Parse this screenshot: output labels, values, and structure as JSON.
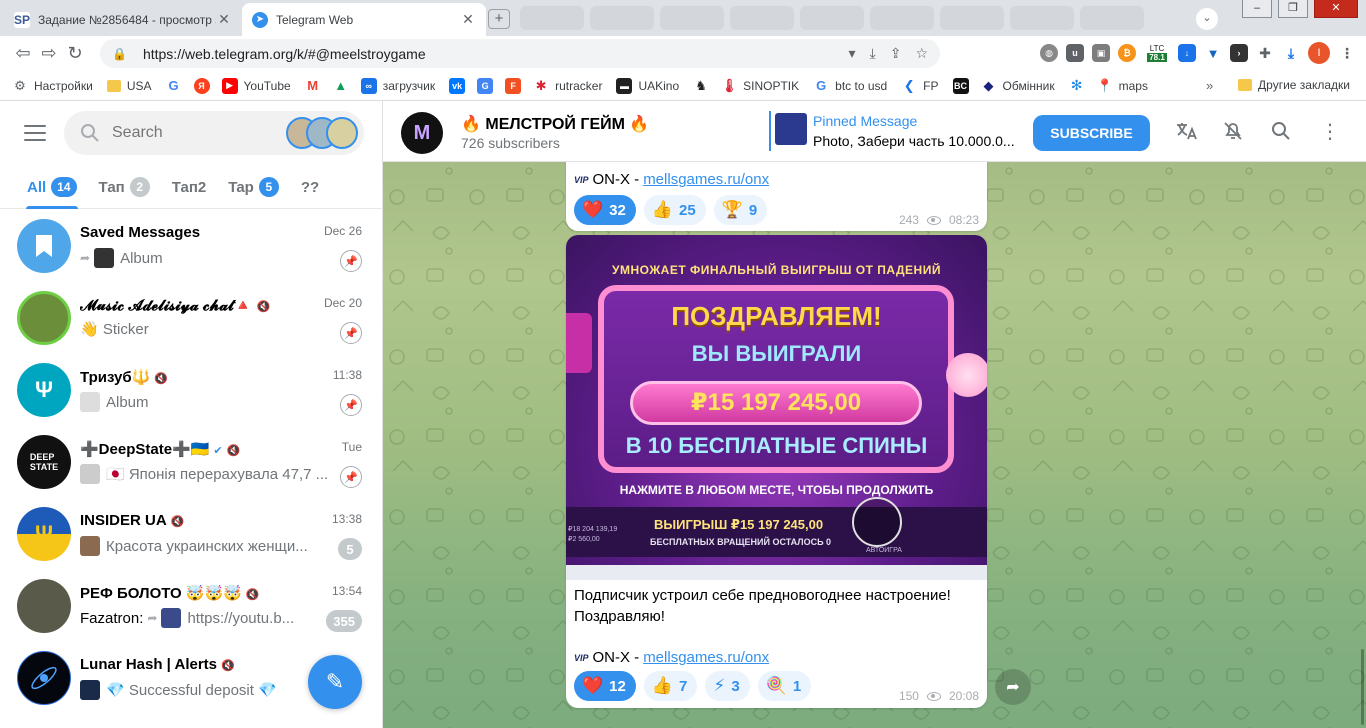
{
  "browser": {
    "tabs": [
      {
        "title": "Задание №2856484 - просмотр з",
        "favicon": "SP",
        "active": false
      },
      {
        "title": "Telegram Web",
        "favicon": "telegram-icon",
        "active": true
      }
    ],
    "url": "https://web.telegram.org/k/#@meelstroygame",
    "ext_ltc": {
      "label": "LTC",
      "value": "78.1",
      "sub": "88865"
    },
    "profile_initial": "I",
    "bookmarks": [
      {
        "label": "Настройки",
        "icon": "gear-icon"
      },
      {
        "label": "USA",
        "icon": "folder-icon"
      },
      {
        "label": "",
        "icon": "google-icon"
      },
      {
        "label": "",
        "icon": "yandex-icon"
      },
      {
        "label": "YouTube",
        "icon": "youtube-icon"
      },
      {
        "label": "",
        "icon": "gmail-icon"
      },
      {
        "label": "",
        "icon": "drive-icon"
      },
      {
        "label": "загрузчик",
        "icon": "infinity-icon"
      },
      {
        "label": "",
        "icon": "vk-icon"
      },
      {
        "label": "",
        "icon": "translate-icon"
      },
      {
        "label": "",
        "icon": "f-icon"
      },
      {
        "label": "rutracker",
        "icon": "rutracker-icon"
      },
      {
        "label": "UAKino",
        "icon": "uakino-icon"
      },
      {
        "label": "",
        "icon": "chess-icon"
      },
      {
        "label": "SINOPTIK",
        "icon": "thermometer-icon"
      },
      {
        "label": "btc to usd",
        "icon": "google-icon"
      },
      {
        "label": "FP",
        "icon": "fp-icon"
      },
      {
        "label": "",
        "icon": "bc-icon"
      },
      {
        "label": "Обмінник",
        "icon": "exchange-icon"
      },
      {
        "label": "",
        "icon": "snowflake-icon"
      },
      {
        "label": "maps",
        "icon": "maps-icon"
      }
    ],
    "other_bookmarks": "Другие закладки"
  },
  "sidebar": {
    "search_placeholder": "Search",
    "folders": [
      {
        "label": "All",
        "count": "14",
        "active": true
      },
      {
        "label": "Тап",
        "count": "2",
        "active": false
      },
      {
        "label": "Тап2",
        "count": "",
        "active": false
      },
      {
        "label": "Tap",
        "count": "5",
        "active": false
      },
      {
        "label": "??",
        "count": "",
        "active": false
      }
    ],
    "chats": [
      {
        "name": "Saved Messages",
        "time": "Dec 26",
        "preview": "Album",
        "sender": "",
        "status": "pinned"
      },
      {
        "name": "𝓜𝓾𝓼𝓲𝓬 𝓐𝓭𝓮𝓵𝓲𝓼𝓲𝔂𝓪 𝓬𝓱𝓪𝓽🔺",
        "time": "Dec 20",
        "preview": "👋 Sticker",
        "sender": "",
        "status": "pinned"
      },
      {
        "name": "Тризуб🔱",
        "time": "11:38",
        "preview": "Album",
        "sender": "",
        "status": "pinned"
      },
      {
        "name": "➕DeepState➕🇺🇦",
        "time": "Tue",
        "preview": "🇯🇵 Японія перерахувала 47,7 ...",
        "sender": "",
        "status": "pinned"
      },
      {
        "name": "INSIDER UA",
        "time": "13:38",
        "preview": "Красота украинских женщи...",
        "sender": "",
        "status": "5"
      },
      {
        "name": "РЕФ БОЛОТО 🤯🤯🤯",
        "time": "13:54",
        "preview": "https://youtu.b...",
        "sender": "Fazatron:",
        "status": "355"
      },
      {
        "name": "Lunar Hash | Alerts",
        "time": "",
        "preview": "💎 Successful deposit 💎",
        "sender": "",
        "status": ""
      }
    ]
  },
  "channel": {
    "title": "🔥 МЕЛСТРОЙ ГЕЙМ 🔥",
    "subscribers": "726 subscribers",
    "pinned_title": "Pinned Message",
    "pinned_text": "Photo, Забери часть 10.000.0...",
    "subscribe_label": "SUBSCRIBE"
  },
  "messages": [
    {
      "vip_label": "VIP",
      "line_prefix": "ON-X -",
      "link": "mellsgames.ru/onx",
      "reactions": [
        {
          "emoji": "❤️",
          "count": "32",
          "mine": true
        },
        {
          "emoji": "👍",
          "count": "25",
          "mine": false
        },
        {
          "emoji": "🏆",
          "count": "9",
          "mine": false
        }
      ],
      "views": "243",
      "time": "08:23"
    },
    {
      "photo": {
        "banner": "УМНОЖАЕТ ФИНАЛЬНЫЙ ВЫИГРЫШ ОТ ПАДЕНИЙ",
        "congrats": "ПОЗДРАВЛЯЕМ!",
        "you_won": "ВЫ ВЫИГРАЛИ",
        "amount": "₽15 197 245,00",
        "spins": "В 10 БЕСПЛАТНЫЕ СПИНЫ",
        "tap": "НАЖМИТЕ В ЛЮБОМ МЕСТЕ, ЧТОБЫ ПРОДОЛЖИТЬ",
        "win_row": "ВЫИГРЫШ ₽15 197 245,00",
        "free_left": "БЕСПЛАТНЫХ ВРАЩЕНИЙ ОСТАЛОСЬ 0",
        "small_a": "₽18 204 139,19",
        "small_b": "₽2 560,00",
        "auto": "АВТОИГРА"
      },
      "caption": "Подписчик устроил себе предновогоднее настроение! Поздравляю!",
      "vip_label": "VIP",
      "line_prefix": "ON-X -",
      "link": "mellsgames.ru/onx",
      "reactions": [
        {
          "emoji": "❤️",
          "count": "12",
          "mine": true
        },
        {
          "emoji": "👍",
          "count": "7",
          "mine": false
        },
        {
          "emoji": "⚡",
          "count": "3",
          "mine": false
        },
        {
          "emoji": "🍭",
          "count": "1",
          "mine": false
        }
      ],
      "views": "150",
      "time": "20:08"
    }
  ],
  "colors": {
    "accent": "#3390ec",
    "danger": "#c42b1c"
  }
}
